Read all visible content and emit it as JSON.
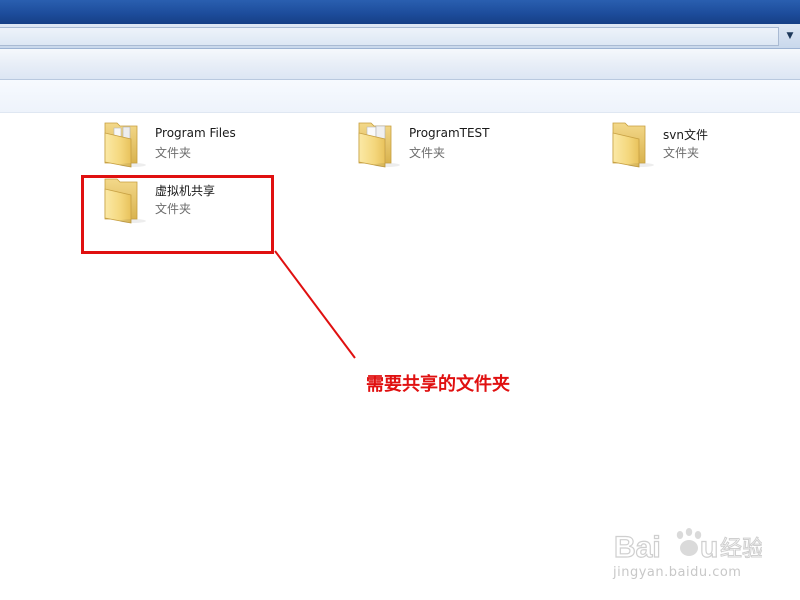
{
  "window": {
    "address_dropdown_icon": "chevron-down-icon"
  },
  "files": [
    {
      "name": "Program Files",
      "type": "文件夹",
      "icon": "folder-with-documents-icon"
    },
    {
      "name": "ProgramTEST",
      "type": "文件夹",
      "icon": "folder-with-documents-icon"
    },
    {
      "name": "svn文件",
      "type": "文件夹",
      "icon": "folder-icon"
    },
    {
      "name": "虚拟机共享",
      "type": "文件夹",
      "icon": "folder-icon"
    }
  ],
  "annotation": {
    "text": "需要共享的文件夹",
    "color": "#e01010"
  },
  "watermark": {
    "logo_text": "Baidu经验",
    "url": "jingyan.baidu.com"
  }
}
